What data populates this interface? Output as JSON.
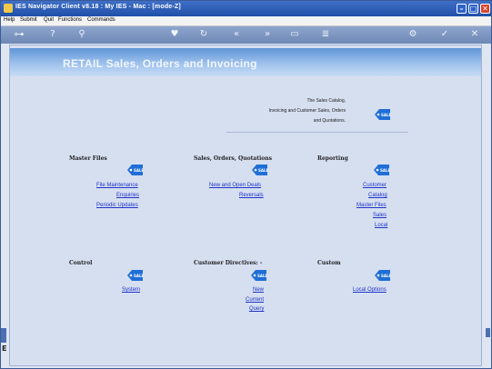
{
  "window": {
    "title": "IES Navigator Client v8.18 : My IES - Mac :     [mode-Z]"
  },
  "menu": [
    "Help",
    "Submit",
    "Quit",
    "Functions",
    "Commands"
  ],
  "banner": {
    "title": "RETAIL Sales, Orders and Invoicing"
  },
  "description": {
    "line1": "The Sales Catalog,",
    "line2": "Invoicing and Customer Sales, Orders",
    "line3": "and Quotations."
  },
  "sections": {
    "master_files": {
      "title": "Master Files",
      "links": [
        "File Maintenance",
        "Enquiries",
        "Periodic Updates"
      ]
    },
    "sales": {
      "title": "Sales, Orders, Quotations",
      "links": [
        "New and Open Deals",
        "Reversals"
      ]
    },
    "reporting": {
      "title": "Reporting",
      "links": [
        "Customer",
        "Catalog",
        "Master Files",
        "Sales",
        "Local"
      ]
    },
    "control": {
      "title": "Control",
      "links": [
        "System"
      ]
    },
    "customer_directives": {
      "title": "Customer Directives: -",
      "links": [
        "New",
        "Current",
        "Query"
      ]
    },
    "custom": {
      "title": "Custom",
      "links": [
        "Local Options"
      ]
    }
  },
  "icons": {
    "tag": "sale-tag-icon",
    "toolbar": [
      "key-icon",
      "help-icon",
      "search-icon",
      "favorite-icon",
      "refresh-icon",
      "back-icon",
      "forward-icon",
      "window-icon",
      "list-icon",
      "settings-icon",
      "ok-icon",
      "cancel-icon"
    ]
  },
  "colors": {
    "link": "#1e34c8",
    "tag": "#1f6fd6",
    "banner": "#5e95d8"
  }
}
